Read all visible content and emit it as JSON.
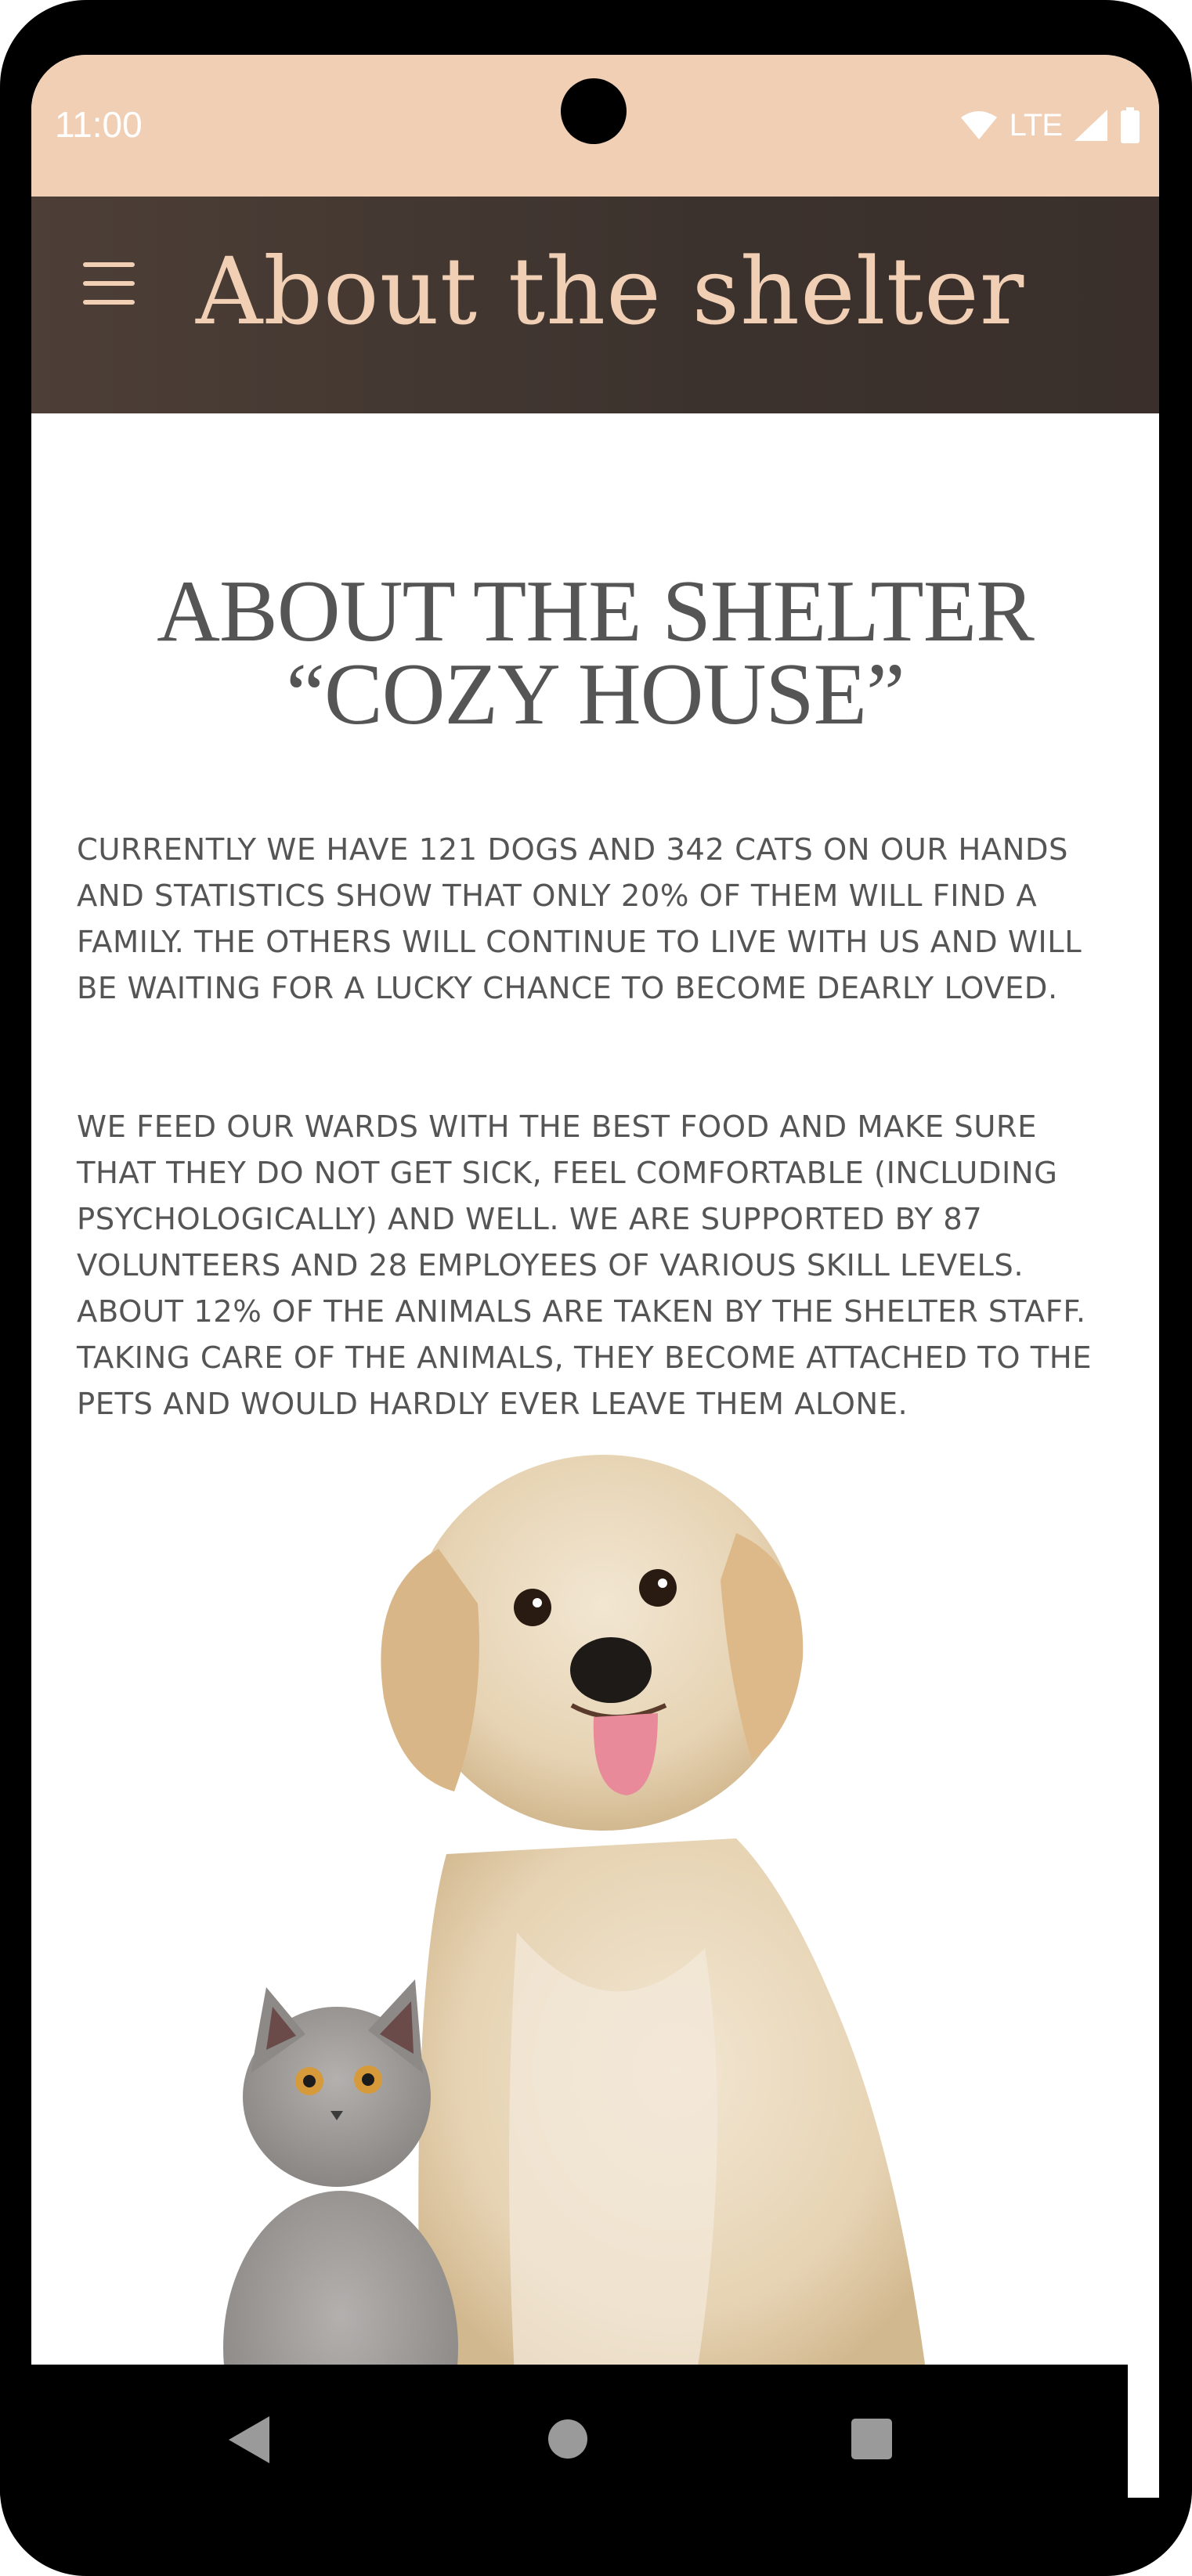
{
  "status_bar": {
    "time": "11:00",
    "network": "LTE",
    "icons": [
      "wifi-icon",
      "signal-icon",
      "battery-icon"
    ]
  },
  "app_bar": {
    "title": "About the shelter",
    "menu_icon": "hamburger-menu-icon"
  },
  "content": {
    "heading_line1": "ABOUT THE SHELTER",
    "heading_line2": "“COZY HOUSE”",
    "paragraph1": "Currently we have 121 dogs and 342 cats on our hands and statistics show that only 20% of them will find a family. The others will continue to live with us and will be waiting for a lucky chance to become dearly loved.",
    "paragraph2": "We feed our wards with the best food and make sure that they do not get sick, feel comfortable (including psychologically) and well. We are supported by 87 volunteers and 28 employees of various skill levels. About 12% of the animals are taken by the shelter staff. Taking care of the animals, they become attached to the pets and would hardly ever leave them alone.",
    "image": "dog-and-cat-image"
  },
  "nav_bar": {
    "buttons": [
      "back-icon",
      "home-icon",
      "recents-icon"
    ]
  },
  "colors": {
    "status_bar_bg": "#f0cfb5",
    "app_bar_bg": "#3c322d",
    "title_color": "#f0cfb5",
    "text_color": "#555555"
  }
}
